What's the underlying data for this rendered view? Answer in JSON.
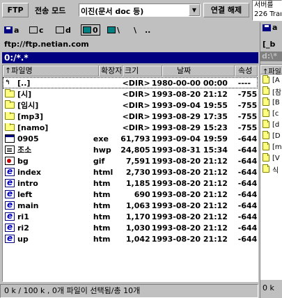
{
  "toolbar": {
    "ftp_label": "FTP",
    "mode_label": "전송 모드",
    "mode_value": "이진(문서 doc 등)",
    "connect_label": "연결 해제",
    "server_line1": "서버를 ",
    "server_line2": "226 Tran"
  },
  "drives": {
    "a": "a",
    "c": "c",
    "d": "d",
    "net": "0",
    "root": "\\",
    "root2": "\\",
    "parent": ".."
  },
  "url": "ftp://ftp.netian.com",
  "path": "0:/*.*",
  "columns": {
    "name": "↑파일명",
    "ext": "확장자",
    "size": "크기",
    "date": "날짜",
    "attr": "속성"
  },
  "files": [
    {
      "name": "[..]",
      "ext": "",
      "size": "<DIR>",
      "date": "1980-00-00 00:00",
      "attr": "----",
      "icon": "up-icon"
    },
    {
      "name": "[시]",
      "ext": "",
      "size": "<DIR>",
      "date": "1993-08-20 21:12",
      "attr": "-755",
      "icon": "folder-icon"
    },
    {
      "name": "[임시]",
      "ext": "",
      "size": "<DIR>",
      "date": "1993-09-04 19:55",
      "attr": "-755",
      "icon": "folder-icon"
    },
    {
      "name": "[mp3]",
      "ext": "",
      "size": "<DIR>",
      "date": "1993-08-29 17:35",
      "attr": "-755",
      "icon": "folder-icon"
    },
    {
      "name": "[namo]",
      "ext": "",
      "size": "<DIR>",
      "date": "1993-08-29 15:23",
      "attr": "-755",
      "icon": "folder-icon"
    },
    {
      "name": "0905",
      "ext": "exe",
      "size": "61,793",
      "date": "1993-09-04 19:59",
      "attr": "-644",
      "icon": "exe-icon"
    },
    {
      "name": "조소",
      "ext": "hwp",
      "size": "24,805",
      "date": "1993-08-31 15:34",
      "attr": "-644",
      "icon": "document-icon"
    },
    {
      "name": "bg",
      "ext": "gif",
      "size": "7,591",
      "date": "1993-08-20 21:12",
      "attr": "-644",
      "icon": "image-icon"
    },
    {
      "name": "index",
      "ext": "html",
      "size": "2,730",
      "date": "1993-08-20 21:12",
      "attr": "-644",
      "icon": "web-page-icon"
    },
    {
      "name": "intro",
      "ext": "htm",
      "size": "1,185",
      "date": "1993-08-20 21:12",
      "attr": "-644",
      "icon": "web-page-icon"
    },
    {
      "name": "left",
      "ext": "htm",
      "size": "690",
      "date": "1993-08-20 21:12",
      "attr": "-644",
      "icon": "web-page-icon"
    },
    {
      "name": "main",
      "ext": "htm",
      "size": "1,063",
      "date": "1993-08-20 21:12",
      "attr": "-644",
      "icon": "web-page-icon"
    },
    {
      "name": "ri1",
      "ext": "htm",
      "size": "1,170",
      "date": "1993-08-20 21:12",
      "attr": "-644",
      "icon": "web-page-icon"
    },
    {
      "name": "ri2",
      "ext": "htm",
      "size": "1,030",
      "date": "1993-08-20 21:12",
      "attr": "-644",
      "icon": "web-page-icon"
    },
    {
      "name": "up",
      "ext": "htm",
      "size": "1,042",
      "date": "1993-08-20 21:12",
      "attr": "-644",
      "icon": "web-page-icon"
    }
  ],
  "status": "0 k / 100 k , 0개 파일이 선택됨/총 10개",
  "right_panel": {
    "drive": "a",
    "url": "[_b",
    "path": "d:\\*",
    "header": "↑파일",
    "items": [
      "[A",
      "[참",
      "[B",
      "[c",
      "[d",
      "[D",
      "[m",
      "[V",
      "식"
    ],
    "status": "0 k"
  },
  "colors": {
    "face": "#c0c0c0",
    "path_bar": "#000080"
  }
}
